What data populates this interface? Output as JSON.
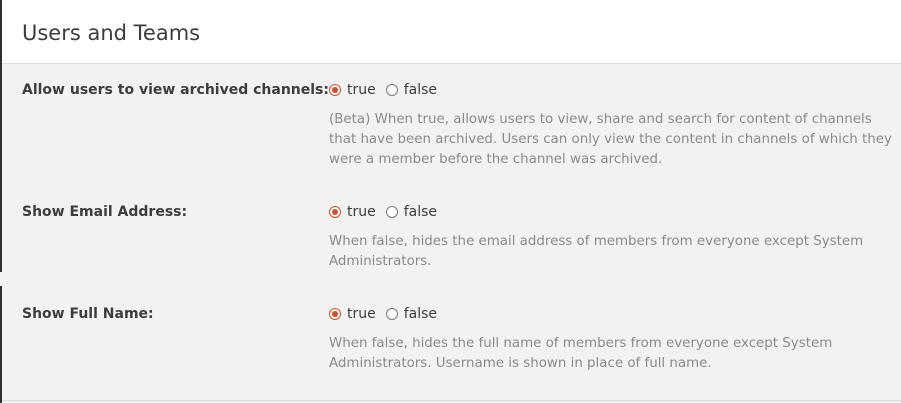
{
  "header": {
    "title": "Users and Teams"
  },
  "settings": [
    {
      "label": "Allow users to view archived channels:",
      "options": {
        "true_label": "true",
        "false_label": "false"
      },
      "selected": "true",
      "help": "(Beta) When true, allows users to view, share and search for content of channels that have been archived. Users can only view the content in channels of which they were a member before the channel was archived."
    },
    {
      "label": "Show Email Address:",
      "options": {
        "true_label": "true",
        "false_label": "false"
      },
      "selected": "true",
      "help": "When false, hides the email address of members from everyone except System Administrators."
    },
    {
      "label": "Show Full Name:",
      "options": {
        "true_label": "true",
        "false_label": "false"
      },
      "selected": "true",
      "help": "When false, hides the full name of members from everyone except System Administrators. Username is shown in place of full name."
    }
  ],
  "colors": {
    "accent": "#d2502a",
    "help_text": "#8a8a8c",
    "label": "#3d3c40"
  }
}
